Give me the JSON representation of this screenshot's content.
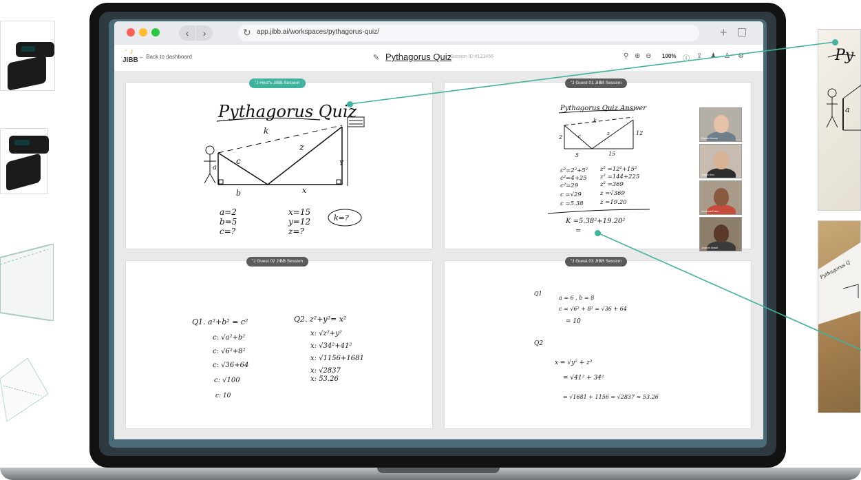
{
  "browser": {
    "url": "app.jibb.ai/workspaces/pythagorus-quiz/",
    "traffic_lights": [
      "#fe5f57",
      "#febc2e",
      "#28c840"
    ]
  },
  "app": {
    "logo_mark": "‟ J",
    "logo": "JIBB",
    "back_link": "←  Back to dashboard",
    "title": "Pythagorus Quiz",
    "session_id": "Session ID #123456",
    "zoom": "100%"
  },
  "panels": {
    "host": {
      "badge": "‟J Host's JIBB Session",
      "title": "Pythagorus Quiz",
      "labels": [
        "k",
        "z",
        "c",
        "a",
        "b",
        "x",
        "Y"
      ],
      "answers_left": [
        "a=2",
        "b=5",
        "c=?"
      ],
      "answers_right": [
        "x=15",
        "y=12",
        "z=?"
      ],
      "question": "k=?"
    },
    "guest1": {
      "badge": "‟J Guest 01 JIBB Session",
      "title": "Pythagorus Quiz Answer",
      "labels": [
        "k",
        "c",
        "z",
        "2",
        "5",
        "15",
        "12"
      ],
      "col1": [
        "c²=2²+5²",
        "c²=4+25",
        "c²=29",
        "c =√29",
        "c =5.38"
      ],
      "col2": [
        "z² =12²+15²",
        "z² =144+225",
        "z² =369",
        "z =√369",
        "z =19.20"
      ],
      "final": [
        "K =5.38²+19.20²",
        "="
      ]
    },
    "guest2": {
      "badge": "‟J Guest 02 JIBB Session",
      "q1": [
        "Q1.  a²+b² = c²",
        "c: √a²+b²",
        "c: √6²+8²",
        "c: √36+64",
        "c: √100",
        "c: 10"
      ],
      "q2": [
        "Q2.  z²+y²= x²",
        "x: √z²+y²",
        "x: √34²+41²",
        "x: √1156+1681",
        "x: √2837",
        "x: 53.26"
      ]
    },
    "guest3": {
      "badge": "‟J Guest 03 JIBB Session",
      "q1_label": "Q1",
      "q1": [
        "a = 6 ,  b = 8",
        "c = √6² + 8²  = √36 + 64",
        "= 10"
      ],
      "q2_label": "Q2",
      "q2": [
        "x =  √y² + z²",
        "=  √41² + 34²",
        "= √1681 + 1156  = √2837  ≈ 53.26"
      ]
    }
  },
  "video_tiles": [
    {
      "name": "Daniel Hamm",
      "skin": "#e6c3a8",
      "shirt": "#6f7f8a",
      "bg": "#b4b0a7"
    },
    {
      "name": "Sarah Kim",
      "skin": "#d9b194",
      "shirt": "#2d2d2d",
      "bg": "#c8bcb0"
    },
    {
      "name": "Amanda Dunn",
      "skin": "#8a5a40",
      "shirt": "#c64b3a",
      "bg": "#a89b8a"
    },
    {
      "name": "Joseph Abadi",
      "skin": "#5a3a2a",
      "shirt": "#3a3a3a",
      "bg": "#8d7d6b"
    }
  ],
  "photo_text": {
    "photo1_title": "Py",
    "photo1_label": "a",
    "photo2_title": "Pythagorus Q"
  },
  "colors": {
    "accent": "#3fb39e",
    "guest_badge": "#5a5a5a"
  }
}
